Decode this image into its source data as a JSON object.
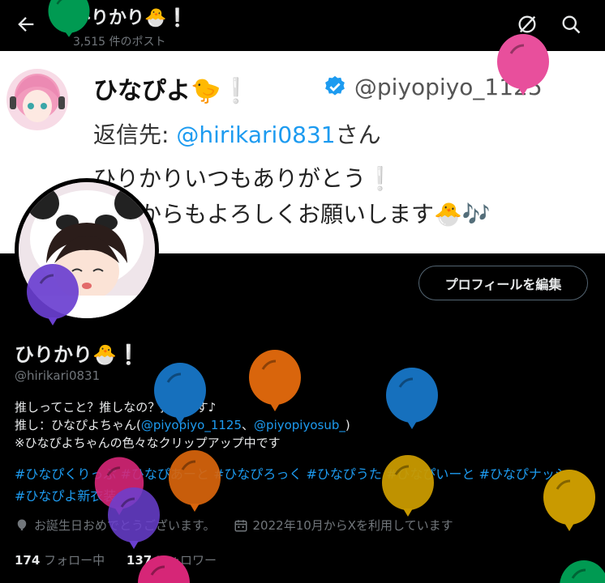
{
  "header": {
    "title": "ひりかり🐣❕",
    "post_count": "3,515 件のポスト"
  },
  "banner": {
    "name": "ひなぴよ🐤❕",
    "handle": "@piyopiyo_1125",
    "reply_prefix": "返信先: ",
    "reply_mention": "@hirikari0831",
    "reply_suffix": "さん",
    "line1": "ひりかりいつもありがとう❕",
    "line2": "これからもよろしくお願いします🐣🎶"
  },
  "profile": {
    "edit_button": "プロフィールを編集",
    "display_name": "ひりかり🐣❕",
    "handle": "@hirikari0831",
    "bio": {
      "line1": "推しってこと？推しなの？推しです♪",
      "line2_prefix": "推し：ひなぴよちゃん(",
      "line2_link1": "@piyopiyo_1125",
      "line2_sep": "、",
      "line2_link2": "@piyopiyosub_",
      "line2_suffix": ")",
      "line3": "※ひなぴよちゃんの色々なクリップアップ中です",
      "hashtags": "#ひなぴくりっぷ #ひなぴあーと #ひなぴろっく #ひなぴうた #ひなぴいーと #ひなぴナッシュ #ひなぴよ新衣装"
    },
    "birthday": "お誕生日おめでとうございます。",
    "joined": "2022年10月からXを利用しています",
    "following_count": "174",
    "following_label": "フォロー中",
    "followers_count": "137",
    "followers_label": "フォロワー"
  },
  "icons": {
    "back": "arrow-left-icon",
    "grok": "grok-icon",
    "search": "search-icon",
    "balloon": "balloon-icon",
    "calendar": "calendar-icon"
  },
  "colors": {
    "accent": "#1d9bf0",
    "background": "#000000",
    "balloon_green": "#009a52",
    "balloon_pink": "#e84f9c",
    "balloon_purple": "#6a3fd0",
    "balloon_blue": "#1670bd",
    "balloon_orange": "#d9650c",
    "balloon_yellow": "#c99a00",
    "balloon_magenta": "#d62677"
  }
}
